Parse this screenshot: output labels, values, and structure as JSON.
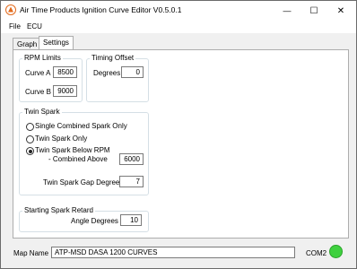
{
  "window": {
    "title": "Air Time Products Ignition Curve Editor V0.5.0.1",
    "minimize_glyph": "—",
    "maximize_glyph": "☐",
    "close_glyph": "✕"
  },
  "menu": {
    "file": "File",
    "ecu": "ECU"
  },
  "tabs": [
    {
      "label": "Graph",
      "active": false
    },
    {
      "label": "Settings",
      "active": true
    }
  ],
  "rpm_limits": {
    "title": "RPM Limits",
    "curve_a_label": "Curve A",
    "curve_a_value": "8500",
    "curve_b_label": "Curve B",
    "curve_b_value": "9000"
  },
  "timing_offset": {
    "title": "Timing Offset",
    "degrees_label": "Degrees",
    "degrees_value": "0"
  },
  "twin_spark": {
    "title": "Twin Spark",
    "options": [
      {
        "label": "Single Combined Spark Only",
        "selected": false
      },
      {
        "label": "Twin Spark Only",
        "selected": false
      },
      {
        "label": "Twin Spark Below RPM",
        "selected": true
      }
    ],
    "combined_above_label": "- Combined Above",
    "combined_above_value": "6000",
    "gap_label": "Twin Spark Gap Degrees",
    "gap_value": "7"
  },
  "starting_retard": {
    "title": "Starting Spark Retard",
    "angle_label": "Angle Degrees",
    "angle_value": "10"
  },
  "status": {
    "map_name_label": "Map Name",
    "map_name_value": "ATP-MSD DASA 1200 CURVES",
    "port": "COM2",
    "connection_color": "#3fd13f"
  }
}
